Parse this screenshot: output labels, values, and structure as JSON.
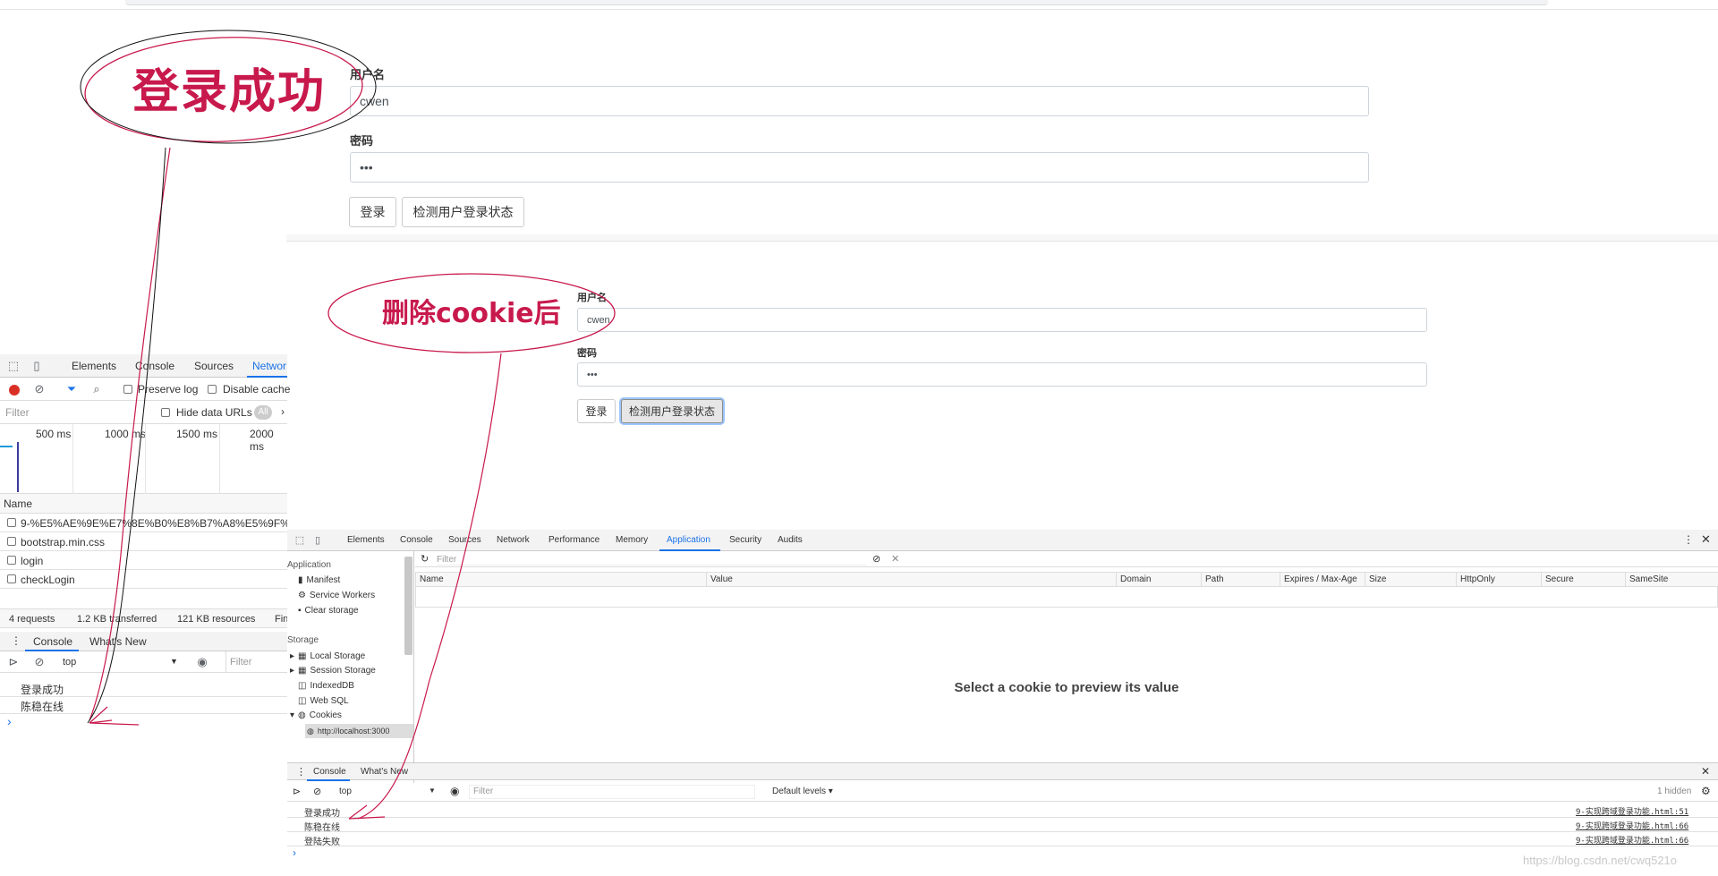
{
  "annotations": {
    "login_success": "登录成功",
    "after_delete_cookie": "删除cookie后"
  },
  "form1": {
    "username_label": "用户名",
    "username_value": "cwen",
    "password_label": "密码",
    "password_value": "•••",
    "login_button": "登录",
    "check_button": "检测用户登录状态"
  },
  "form2": {
    "username_label": "用户名",
    "username_value": "cwen",
    "password_label": "密码",
    "password_value": "•••",
    "login_button": "登录",
    "check_button": "检测用户登录状态"
  },
  "devtools_left": {
    "tabs": [
      "Elements",
      "Console",
      "Sources",
      "Networ"
    ],
    "preserve_log": "Preserve log",
    "disable_cache": "Disable cache",
    "filter_placeholder": "Filter",
    "hide_data_urls": "Hide data URLs",
    "all_badge": "All",
    "timeline_ticks": [
      "500 ms",
      "1000 ms",
      "1500 ms",
      "2000 ms"
    ],
    "name_header": "Name",
    "requests": [
      "9-%E5%AE%9E%E7%8E%B0%E8%B7%A8%E5%9F%9F%E",
      "bootstrap.min.css",
      "login",
      "checkLogin"
    ],
    "summary": [
      "4 requests",
      "1.2 KB transferred",
      "121 KB resources",
      "Fin"
    ],
    "drawer_tabs": [
      "Console",
      "What's New"
    ],
    "context": "top",
    "console_filter": "Filter",
    "console_lines": [
      "登录成功",
      "陈稳在线"
    ],
    "prompt": "›"
  },
  "devtools_right": {
    "tabs": [
      "Elements",
      "Console",
      "Sources",
      "Network",
      "Performance",
      "Memory",
      "Application",
      "Security",
      "Audits"
    ],
    "sidebar_application": "Application",
    "app_items": [
      "Manifest",
      "Service Workers",
      "Clear storage"
    ],
    "sidebar_storage": "Storage",
    "storage_items": [
      "Local Storage",
      "Session Storage",
      "IndexedDB",
      "Web SQL",
      "Cookies"
    ],
    "cookie_origin": "http://localhost:3000",
    "filter_placeholder": "Filter",
    "columns": [
      "Name",
      "Value",
      "Domain",
      "Path",
      "Expires / Max-Age",
      "Size",
      "HttpOnly",
      "Secure",
      "SameSite"
    ],
    "preview_message": "Select a cookie to preview its value",
    "drawer_tabs": [
      "Console",
      "What's New"
    ],
    "context": "top",
    "console_filter": "Filter",
    "levels": "Default levels ▾",
    "hidden": "1 hidden",
    "console_lines": [
      {
        "text": "登录成功",
        "source": "9-实现跨域登录功能.html:51"
      },
      {
        "text": "陈稳在线",
        "source": "9-实现跨域登录功能.html:66"
      },
      {
        "text": "登陆失败",
        "source": "9-实现跨域登录功能.html:66"
      }
    ],
    "prompt": "›"
  },
  "watermark": "https://blog.csdn.net/cwq521o",
  "colors": {
    "annotation": "#c8194c",
    "devtools_bar": "#f3f3f3",
    "accent": "#1a73e8"
  }
}
